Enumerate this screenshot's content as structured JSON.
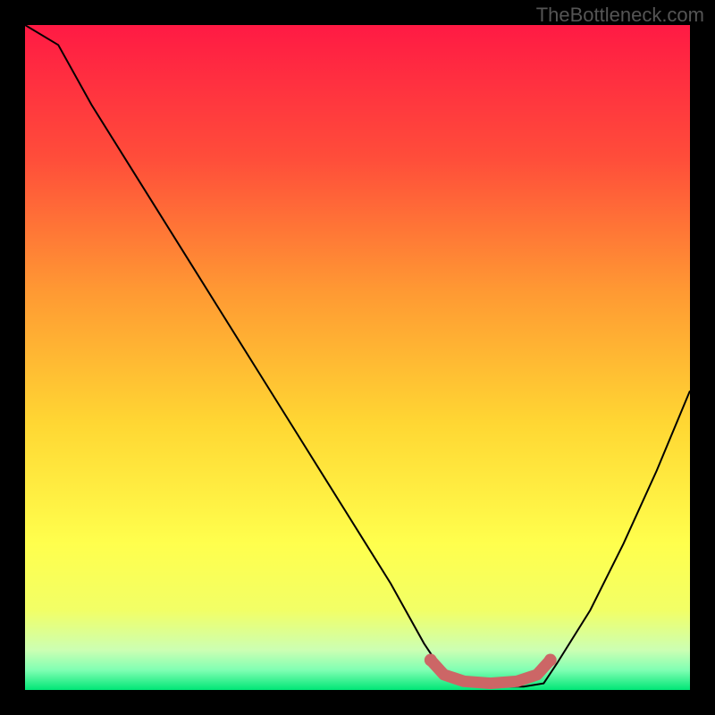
{
  "watermark": "TheBottleneck.com",
  "chart_data": {
    "type": "line",
    "title": "",
    "xlabel": "",
    "ylabel": "",
    "xlim": [
      0,
      100
    ],
    "ylim": [
      0,
      100
    ],
    "curve": {
      "x": [
        0,
        5,
        10,
        15,
        20,
        25,
        30,
        35,
        40,
        45,
        50,
        55,
        60,
        62,
        65,
        70,
        75,
        78,
        80,
        85,
        90,
        95,
        100
      ],
      "y": [
        100,
        97,
        88,
        80,
        72,
        64,
        56,
        48,
        40,
        32,
        24,
        16,
        7,
        4,
        1,
        0.5,
        0.5,
        1,
        4,
        12,
        22,
        33,
        45
      ]
    },
    "highlight_band": {
      "x": [
        61,
        63,
        66,
        70,
        74,
        77,
        79
      ],
      "y": [
        4.5,
        2.3,
        1.3,
        1.0,
        1.3,
        2.3,
        4.5
      ]
    },
    "gradient_stops": [
      {
        "pos": 0.0,
        "color": "#ff1a44"
      },
      {
        "pos": 0.2,
        "color": "#ff4d3a"
      },
      {
        "pos": 0.4,
        "color": "#ff9933"
      },
      {
        "pos": 0.6,
        "color": "#ffd733"
      },
      {
        "pos": 0.78,
        "color": "#ffff4d"
      },
      {
        "pos": 0.88,
        "color": "#f2ff66"
      },
      {
        "pos": 0.94,
        "color": "#ccffb3"
      },
      {
        "pos": 0.97,
        "color": "#80ffb3"
      },
      {
        "pos": 1.0,
        "color": "#00e676"
      }
    ],
    "highlight_color": "#cc6666"
  }
}
